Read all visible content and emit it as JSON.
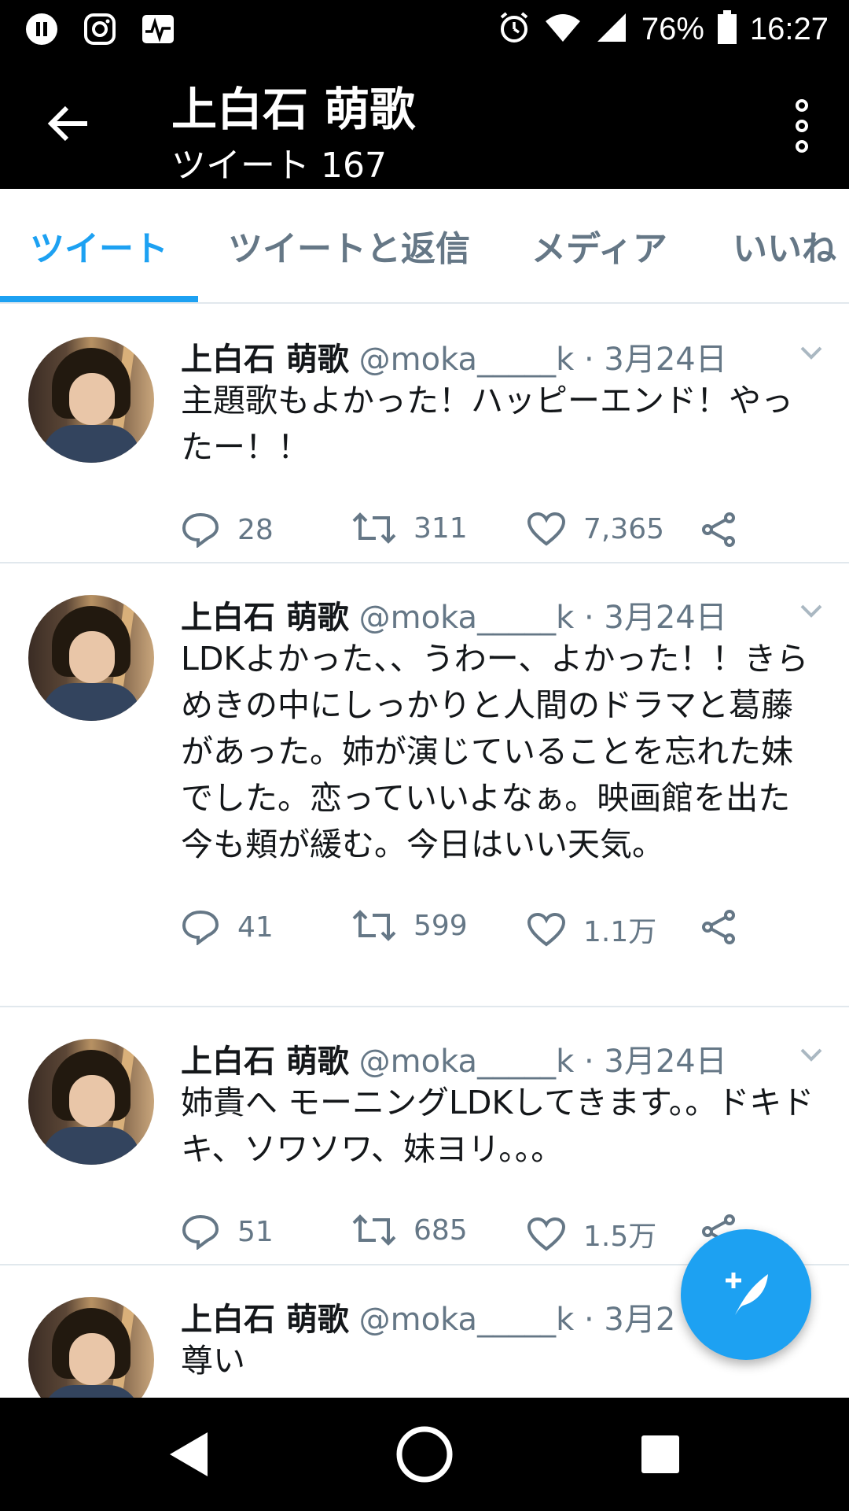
{
  "status_bar": {
    "battery": "76%",
    "time": "16:27",
    "icons": [
      "pause-icon",
      "instagram-icon",
      "pulse-icon",
      "alarm-icon",
      "wifi-icon",
      "signal-icon",
      "battery-icon"
    ]
  },
  "header": {
    "title": "上白石 萌歌",
    "subtitle": "ツイート 167"
  },
  "tabs": [
    {
      "label": "ツイート",
      "active": true
    },
    {
      "label": "ツイートと返信",
      "active": false
    },
    {
      "label": "メディア",
      "active": false
    },
    {
      "label": "いいね",
      "active": false
    }
  ],
  "tweets": [
    {
      "name": "上白石 萌歌",
      "handle": "@moka_____k",
      "separator": "·",
      "date": "3月24日",
      "text": "主題歌もよかった！ハッピーエンド！やったー！！",
      "replies": "28",
      "retweets": "311",
      "likes": "7,365"
    },
    {
      "name": "上白石 萌歌",
      "handle": "@moka_____k",
      "separator": "·",
      "date": "3月24日",
      "text": "LDKよかった、、うわー、よかった！！きらめきの中にしっかりと人間のドラマと葛藤があった。姉が演じていることを忘れた妹でした。恋っていいよなぁ。映画館を出た今も頬が緩む。今日はいい天気。",
      "replies": "41",
      "retweets": "599",
      "likes": "1.1万"
    },
    {
      "name": "上白石 萌歌",
      "handle": "@moka_____k",
      "separator": "·",
      "date": "3月24日",
      "text": "姉貴へ モーニングLDKしてきます。。ドキドキ、ソワソワ、妹ヨリ。。。",
      "replies": "51",
      "retweets": "685",
      "likes": "1.5万"
    },
    {
      "name": "上白石 萌歌",
      "handle": "@moka_____k",
      "separator": "·",
      "date": "3月2",
      "text": "尊い",
      "replies": "",
      "retweets": "",
      "likes": ""
    }
  ],
  "colors": {
    "accent": "#1da1f2",
    "secondary_text": "#657786",
    "divider": "#e1e8ed"
  }
}
